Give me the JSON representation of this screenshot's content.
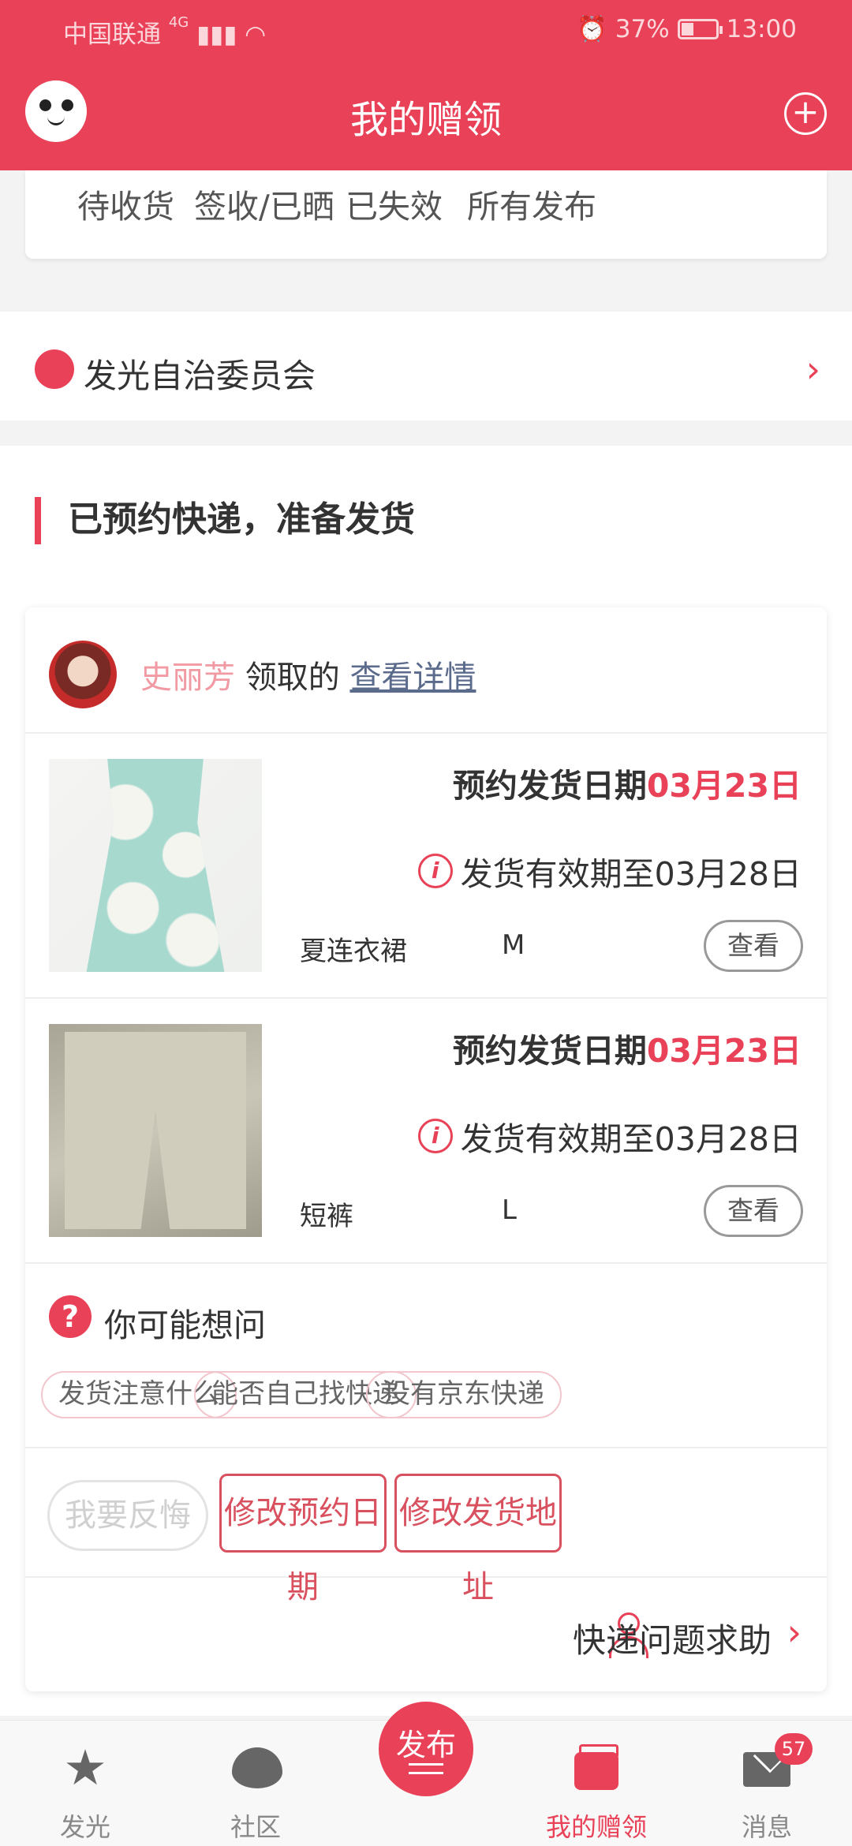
{
  "status_bar": {
    "carrier": "中国联通",
    "network": "4G",
    "battery_percent": "37%",
    "time": "13:00"
  },
  "app_bar": {
    "title": "我的赠领"
  },
  "tabs": [
    "待收货",
    "签收/已晒",
    "已失效",
    "所有发布"
  ],
  "committee": {
    "label": "发光自治委员会"
  },
  "section": {
    "title": "已预约快递，准备发货"
  },
  "order": {
    "recipient_name": "史丽芳",
    "recipient_suffix": "领取的",
    "detail_link": "查看详情",
    "items": [
      {
        "date_label": "预约发货日期",
        "date_value": "03月23日",
        "valid_text": "发货有效期至03月28日",
        "name": "夏连衣裙",
        "size": "M",
        "view_label": "查看"
      },
      {
        "date_label": "预约发货日期",
        "date_value": "03月23日",
        "valid_text": "发货有效期至03月28日",
        "name": "短裤",
        "size": "L",
        "view_label": "查看"
      }
    ],
    "faq": {
      "title": "你可能想问",
      "chips": [
        "发货注意什么",
        "能否自己找快递",
        "没有京东快递"
      ]
    },
    "actions": {
      "regret": "我要反悔",
      "change_date": "修改预约日期",
      "change_address": "修改发货地址"
    },
    "help": {
      "label": "快递问题求助"
    }
  },
  "bottom_nav": {
    "items": [
      {
        "label": "发光",
        "icon": "star-icon"
      },
      {
        "label": "社区",
        "icon": "chat-bubble-icon"
      },
      {
        "label": "发布",
        "icon": "publish-icon"
      },
      {
        "label": "我的赠领",
        "icon": "wallet-icon"
      },
      {
        "label": "消息",
        "icon": "mail-icon"
      }
    ],
    "message_badge": "57"
  },
  "colors": {
    "brand": "#e94157",
    "link": "#5b6b8c"
  }
}
